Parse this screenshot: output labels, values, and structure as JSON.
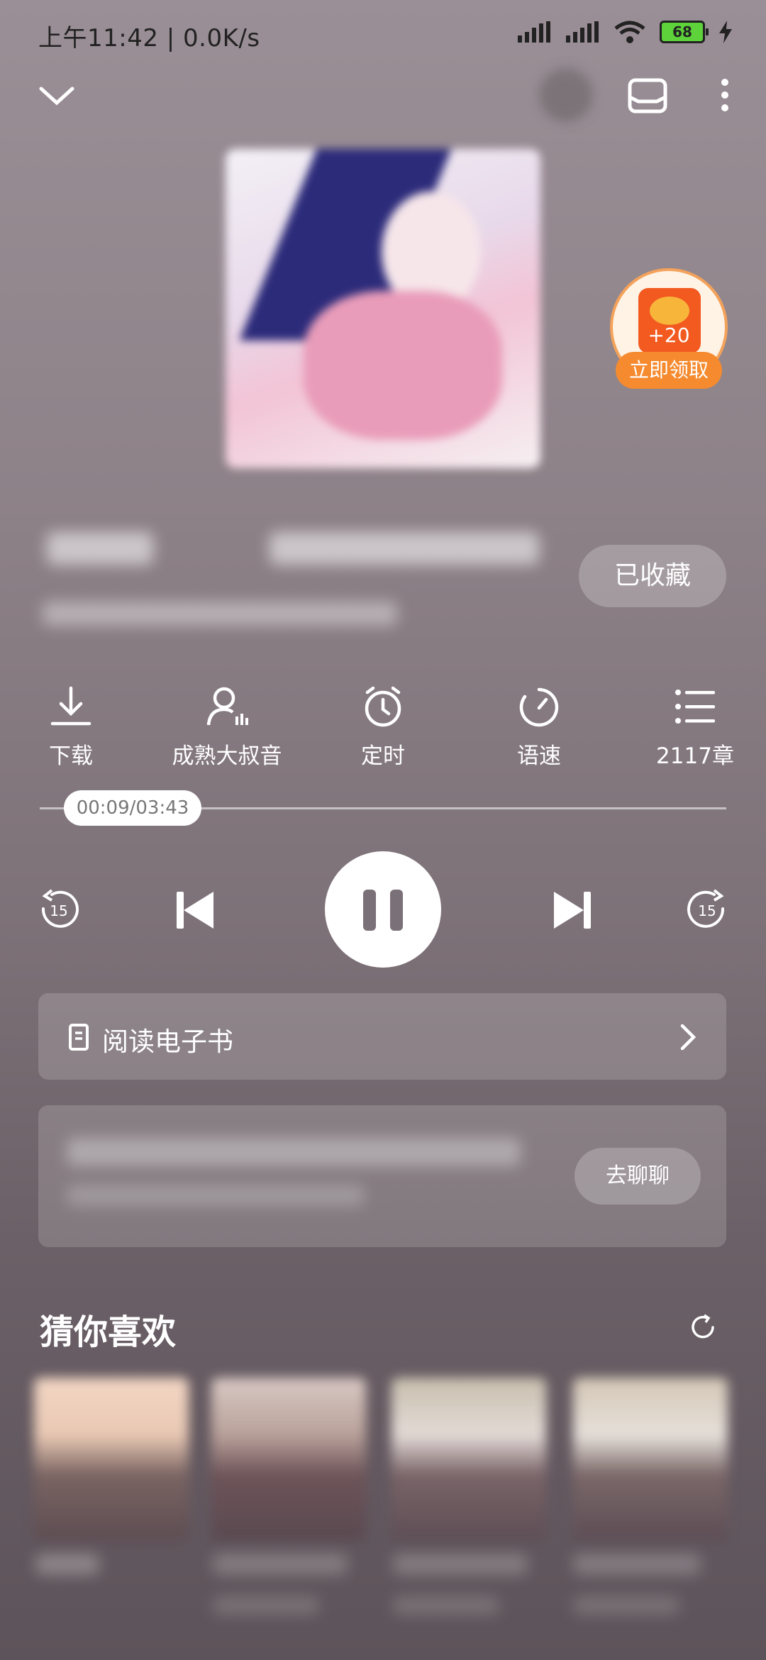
{
  "status_bar": {
    "time": "上午11:42 | 0.0K/s",
    "battery": "68"
  },
  "header": {
    "icons": [
      "collapse-chevron-icon",
      "car-mode-icon",
      "more-vertical-icon"
    ]
  },
  "reward": {
    "amount": "+20",
    "claim_label": "立即领取"
  },
  "favorite": {
    "label": "已收藏"
  },
  "controls": [
    {
      "icon": "download-icon",
      "label": "下载"
    },
    {
      "icon": "voice-icon",
      "label": "成熟大叔音"
    },
    {
      "icon": "timer-icon",
      "label": "定时"
    },
    {
      "icon": "speed-icon",
      "label": "语速"
    },
    {
      "icon": "chapter-list-icon",
      "label": "2117章"
    }
  ],
  "progress": {
    "time_display": "00:09/03:43",
    "fraction": 0.04
  },
  "player": {
    "rewind_seconds": "15",
    "forward_seconds": "15"
  },
  "ebook": {
    "label": "阅读电子书"
  },
  "chat": {
    "button_label": "去聊聊"
  },
  "recommend": {
    "title": "猜你喜欢"
  }
}
